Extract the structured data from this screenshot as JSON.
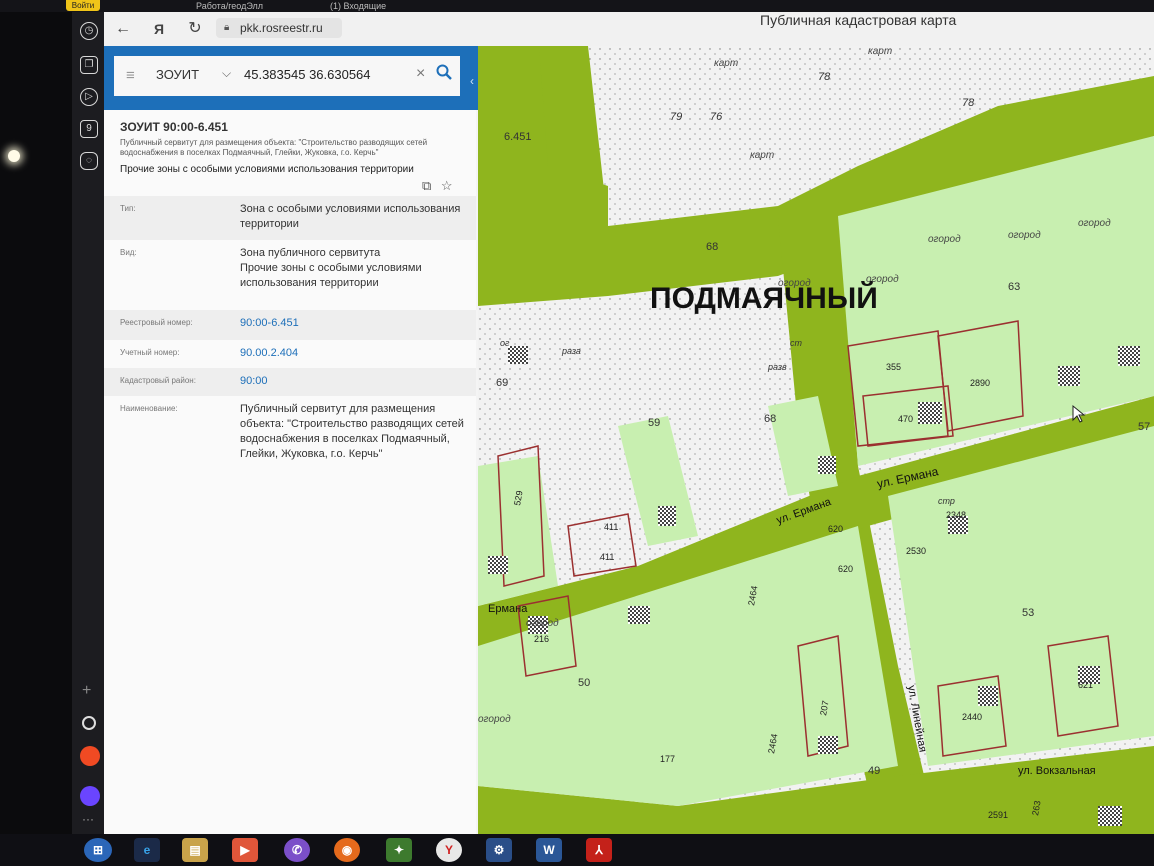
{
  "top_strip": {
    "login_label": "Войти",
    "tab1": "Работа/геодЭлл",
    "tab2": "(1) Входящие"
  },
  "browser": {
    "url": "pkk.rosreestr.ru",
    "page_title": "Публичная кадастровая карта"
  },
  "search": {
    "filter": "ЗОУИТ",
    "value": "45.383545 36.630564"
  },
  "panel": {
    "title": "ЗОУИТ 90:00-6.451",
    "description": "Публичный сервитут для размещения объекта: \"Строительство разводящих сетей водоснабжения в поселках Подмаячный, Глейки, Жуковка, г.о. Керчь\"",
    "subtitle": "Прочие зоны с особыми условиями использования территории",
    "rows": [
      {
        "key": "Тип:",
        "value": "Зона с особыми условиями использования территории",
        "link": false
      },
      {
        "key": "Вид:",
        "value": "Зона публичного сервитута\nПрочие зоны с особыми условиями использования территории",
        "link": false
      },
      {
        "key": "Реестровый номер:",
        "value": "90:00-6.451",
        "link": true
      },
      {
        "key": "Учетный номер:",
        "value": "90.00.2.404",
        "link": true
      },
      {
        "key": "Кадастровый район:",
        "value": "90:00",
        "link": true
      },
      {
        "key": "Наименование:",
        "value": "Публичный сервитут для размещения объекта: \"Строительство разводящих сетей водоснабжения в поселках Подмаячный, Глейки, Жуковка, г.о. Керчь\"",
        "link": false
      }
    ]
  },
  "map": {
    "place_label": "ПОДМАЯЧНЫЙ",
    "zone_label": "6.451",
    "street_ermana": "ул. Ермана",
    "street_ermana2": "ул. Ермана",
    "street_ermana3": "Ермана",
    "street_lineynaya": "ул. Линейная",
    "street_vokzalnaya": "ул. Вокзальная",
    "labels": [
      "карт",
      "карт",
      "карт",
      "78",
      "78",
      "79",
      "76",
      "огород",
      "огород",
      "огород",
      "огород",
      "огород",
      "огород",
      "огород",
      "63",
      "69",
      "59",
      "68",
      "68",
      "53",
      "50",
      "49",
      "57",
      "раза",
      "разв",
      "стр",
      "ст",
      "ог"
    ],
    "numbers": [
      "355",
      "470",
      "2890",
      "411",
      "411",
      "620",
      "620",
      "2348",
      "2530",
      "216",
      "2464",
      "207",
      "177",
      "2464",
      "2440",
      "621",
      "2591",
      "263",
      "529"
    ],
    "colors": {
      "servitude": "#8fb51e",
      "zone": "#c8efb0",
      "parcel_border": "#9b3030"
    }
  },
  "taskbar": {
    "icons": [
      "windows-start",
      "ie",
      "explorer",
      "media",
      "viber",
      "firefox",
      "game",
      "yandex",
      "tool",
      "word",
      "pdf"
    ]
  }
}
